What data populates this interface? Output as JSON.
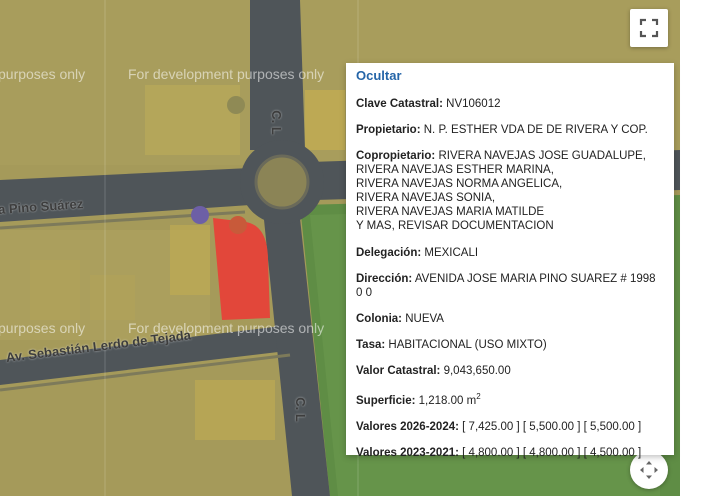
{
  "map": {
    "watermark": "For development purposes only",
    "watermark_partial": "purposes only",
    "streets": {
      "pino_suarez": "a Pino Suárez",
      "lerdo": "Av. Sebastián Lerdo de Tejada",
      "cl_top": "C. L",
      "cl_bottom": "C. L"
    },
    "colors": {
      "land": "#a59a5a",
      "road": "#4f5559",
      "park": "#5f8d45",
      "parcel": "#e2473a"
    }
  },
  "controls": {
    "fullscreen_icon": "fullscreen-icon",
    "pan_icon": "move-arrows-icon"
  },
  "info": {
    "hide_label": "Ocultar",
    "clave": {
      "label": "Clave Catastral:",
      "value": "NV106012"
    },
    "propietario": {
      "label": "Propietario:",
      "value": "N. P. ESTHER VDA DE DE RIVERA Y COP."
    },
    "copropietario": {
      "label": "Copropietario:",
      "first": "RIVERA NAVEJAS JOSE GUADALUPE,",
      "lines": [
        "RIVERA NAVEJAS ESTHER MARINA,",
        "RIVERA NAVEJAS NORMA ANGELICA,",
        "RIVERA NAVEJAS SONIA,",
        "RIVERA NAVEJAS MARIA MATILDE",
        "Y MAS, REVISAR DOCUMENTACION"
      ]
    },
    "delegacion": {
      "label": "Delegación:",
      "value": "MEXICALI"
    },
    "direccion": {
      "label": "Dirección:",
      "value": "AVENIDA JOSE MARIA PINO SUAREZ # 1998 0 0"
    },
    "colonia": {
      "label": "Colonia:",
      "value": "NUEVA"
    },
    "tasa": {
      "label": "Tasa:",
      "value": "HABITACIONAL (USO MIXTO)"
    },
    "valor": {
      "label": "Valor Catastral:",
      "value": "9,043,650.00"
    },
    "superficie": {
      "label": "Superficie:",
      "value": "1,218.00 m",
      "unit_sup": "2"
    },
    "valores_2026": {
      "label": "Valores 2026-2024:",
      "value": "[ 7,425.00 ] [ 5,500.00 ] [ 5,500.00 ]"
    },
    "valores_2023": {
      "label": "Valores 2023-2021:",
      "value": "[ 4,800.00 ] [ 4,800.00 ] [ 4,500.00 ]"
    }
  }
}
